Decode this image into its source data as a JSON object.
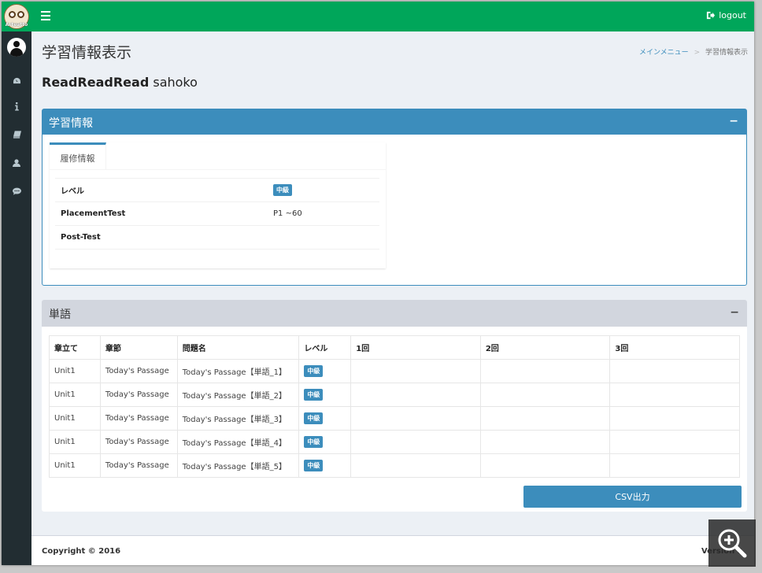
{
  "header": {
    "logo_text": "Arteatto",
    "logout_label": "logout"
  },
  "page": {
    "title": "学習情報表示",
    "breadcrumb": [
      "メインメニュー",
      "学習情報表示"
    ],
    "user_bold": "ReadReadRead",
    "user_name": "sahoko"
  },
  "learning_box": {
    "title": "学習情報",
    "collapse": "−",
    "tab_label": "履修情報",
    "rows": [
      {
        "label": "レベル",
        "value": "中級",
        "is_badge": true
      },
      {
        "label": "PlacementTest",
        "value": "P1 ~60",
        "is_badge": false
      },
      {
        "label": "Post-Test",
        "value": "",
        "is_badge": false
      }
    ]
  },
  "words_box": {
    "title": "単語",
    "collapse": "−",
    "columns": [
      "章立て",
      "章節",
      "問題名",
      "レベル",
      "1回",
      "2回",
      "3回"
    ],
    "rows": [
      [
        "Unit1",
        "Today's Passage",
        "Today's Passage【単語_1】",
        "中級",
        "",
        "",
        ""
      ],
      [
        "Unit1",
        "Today's Passage",
        "Today's Passage【単語_2】",
        "中級",
        "",
        "",
        ""
      ],
      [
        "Unit1",
        "Today's Passage",
        "Today's Passage【単語_3】",
        "中級",
        "",
        "",
        ""
      ],
      [
        "Unit1",
        "Today's Passage",
        "Today's Passage【単語_4】",
        "中級",
        "",
        "",
        ""
      ],
      [
        "Unit1",
        "Today's Passage",
        "Today's Passage【単語_5】",
        "中級",
        "",
        "",
        ""
      ]
    ],
    "csv_label": "CSV出力"
  },
  "footer": {
    "copyright": "Copyright © 2016",
    "version_label": "Version",
    "version_value": "3."
  },
  "colors": {
    "header": "#00a65a",
    "sidebar": "#222d32",
    "primary": "#3c8dbc"
  }
}
